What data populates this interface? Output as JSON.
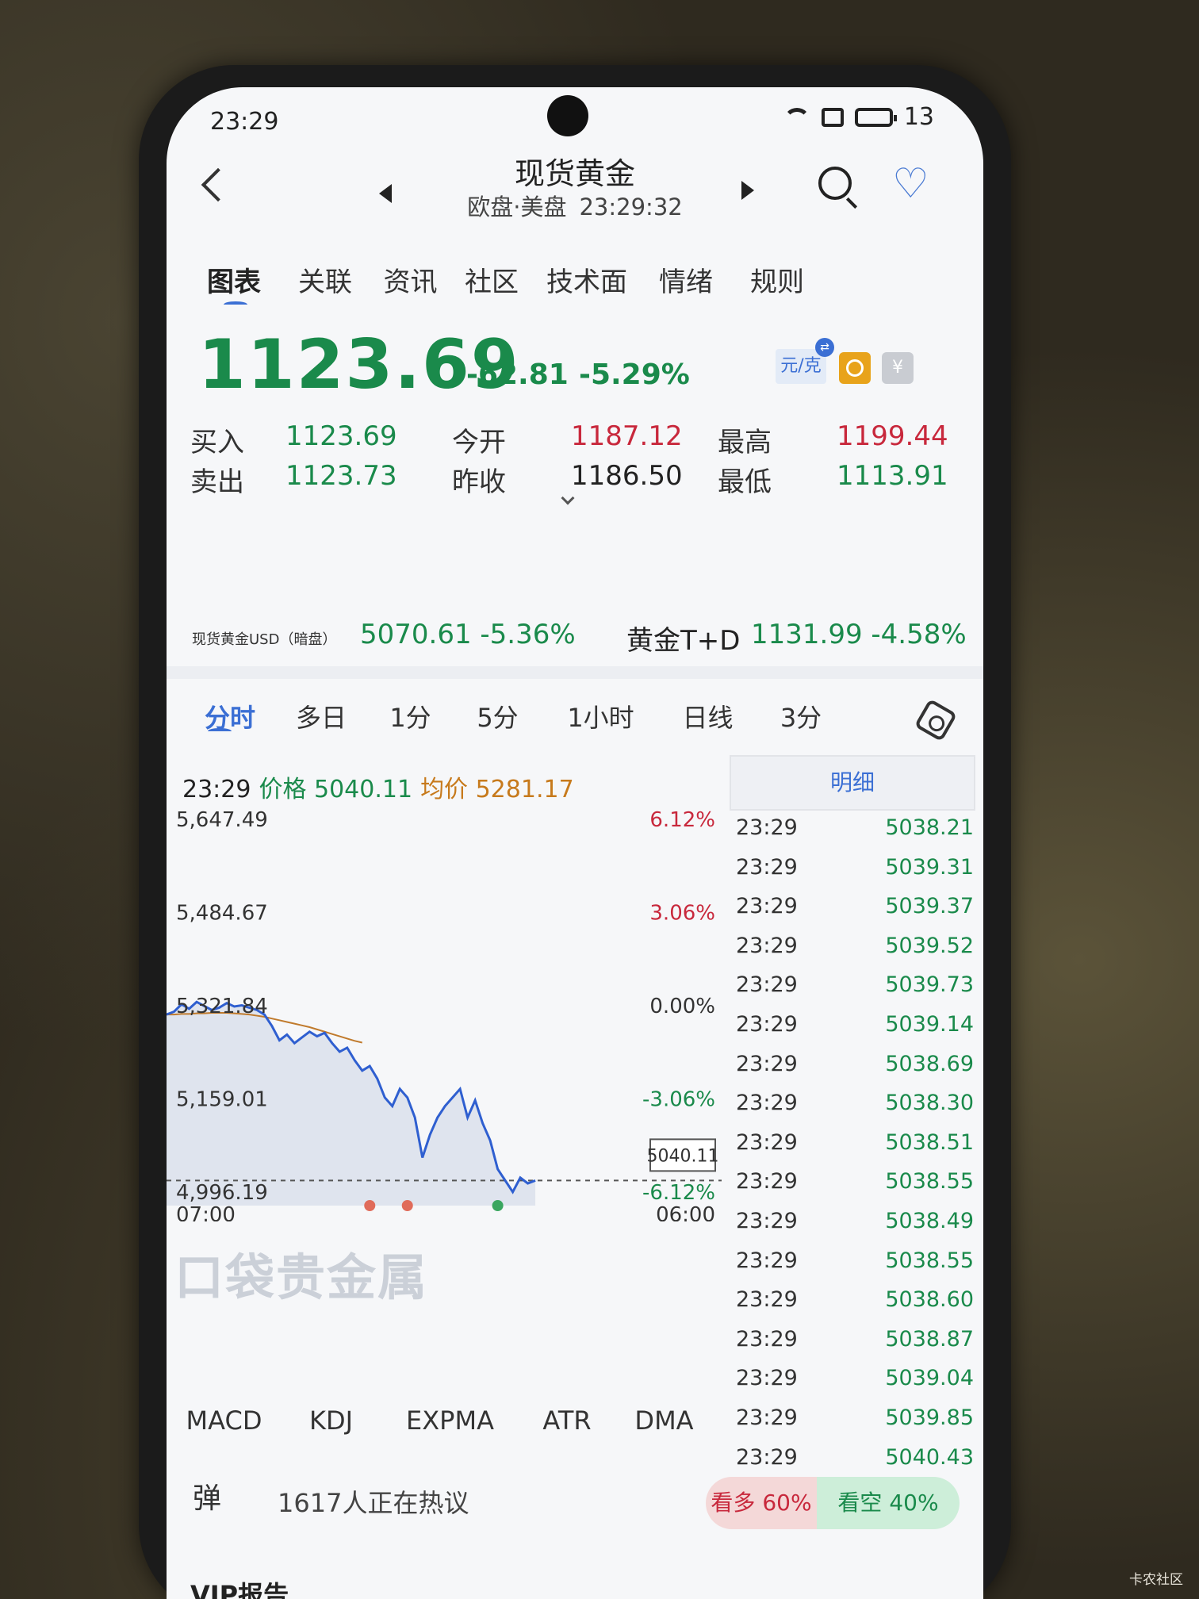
{
  "status": {
    "time": "23:29",
    "battery": "13"
  },
  "header": {
    "title": "现货黄金",
    "session": "欧盘·美盘",
    "clock": "23:29:32"
  },
  "tabs": [
    "图表",
    "关联",
    "资讯",
    "社区",
    "技术面",
    "情绪",
    "规则"
  ],
  "quote": {
    "price": "1123.69",
    "change": "-62.81",
    "change_pct": "-5.29%",
    "unit": "元/克",
    "rows": [
      {
        "l1": "买入",
        "v1": "1123.69",
        "l2": "今开",
        "v2": "1187.12",
        "l3": "最高",
        "v3": "1199.44"
      },
      {
        "l1": "卖出",
        "v1": "1123.73",
        "l2": "昨收",
        "v2": "1186.50",
        "l3": "最低",
        "v3": "1113.91"
      }
    ]
  },
  "related": {
    "name1": "现货黄金USD（暗盘）",
    "val1": "5070.61 -5.36%",
    "name2": "黄金T+D",
    "val2": "1131.99 -4.58%"
  },
  "chart_tabs": [
    "分时",
    "多日",
    "1分",
    "5分",
    "1小时",
    "日线",
    "3分"
  ],
  "chart_info": {
    "time": "23:29",
    "price_label": "价格 5040.11",
    "avg_label": "均价 5281.17"
  },
  "detail_tab": "明细",
  "detail_rows": [
    {
      "t": "23:29",
      "p": "5038.21"
    },
    {
      "t": "23:29",
      "p": "5039.31"
    },
    {
      "t": "23:29",
      "p": "5039.37"
    },
    {
      "t": "23:29",
      "p": "5039.52"
    },
    {
      "t": "23:29",
      "p": "5039.73"
    },
    {
      "t": "23:29",
      "p": "5039.14"
    },
    {
      "t": "23:29",
      "p": "5038.69"
    },
    {
      "t": "23:29",
      "p": "5038.30"
    },
    {
      "t": "23:29",
      "p": "5038.51"
    },
    {
      "t": "23:29",
      "p": "5038.55"
    },
    {
      "t": "23:29",
      "p": "5038.49"
    },
    {
      "t": "23:29",
      "p": "5038.55"
    },
    {
      "t": "23:29",
      "p": "5038.60"
    },
    {
      "t": "23:29",
      "p": "5038.87"
    },
    {
      "t": "23:29",
      "p": "5039.04"
    },
    {
      "t": "23:29",
      "p": "5039.85"
    },
    {
      "t": "23:29",
      "p": "5040.43"
    }
  ],
  "chart_data": {
    "type": "line",
    "y_labels_left": [
      "5,647.49",
      "5,484.67",
      "5,321.84",
      "5,159.01",
      "4,996.19"
    ],
    "y_labels_right": [
      "6.12%",
      "3.06%",
      "0.00%",
      "-3.06%",
      "-6.12%"
    ],
    "ylim": [
      4996.19,
      5647.49
    ],
    "x_labels": [
      "07:00",
      "06:00"
    ],
    "last_price_tag": "5040.11",
    "series": [
      {
        "values": [
          5330,
          5335,
          5348,
          5340,
          5352,
          5345,
          5338,
          5342,
          5350,
          5344,
          5346,
          5342,
          5338,
          5330,
          5310,
          5285,
          5295,
          5280,
          5290,
          5300,
          5292,
          5298,
          5280,
          5265,
          5272,
          5250,
          5232,
          5240,
          5218,
          5185,
          5170,
          5200,
          5185,
          5150,
          5080,
          5120,
          5150,
          5170,
          5185,
          5200,
          5150,
          5180,
          5140,
          5110,
          5060,
          5040,
          5020,
          5045,
          5035,
          5040
        ]
      },
      {
        "values": [
          5330,
          5330,
          5331,
          5331,
          5332,
          5332,
          5333,
          5333,
          5333,
          5332,
          5331,
          5330,
          5328,
          5326,
          5323,
          5320,
          5317,
          5314,
          5311,
          5308,
          5304,
          5300,
          5296,
          5292,
          5288,
          5284,
          5281
        ]
      }
    ],
    "markers": [
      {
        "x": 27,
        "color": "#e06b5a"
      },
      {
        "x": 32,
        "color": "#e06b5a"
      },
      {
        "x": 44,
        "color": "#3aa65f"
      }
    ],
    "colors": {
      "price": "#2f5fd0",
      "avg": "#c07a2c",
      "fill": "#dfe4ee"
    }
  },
  "indicators": [
    "MACD",
    "KDJ",
    "EXPMA",
    "ATR",
    "DMA"
  ],
  "bottom": {
    "bullet_glyph": "弹",
    "discuss": "1617人正在热议",
    "bull": "看多 60%",
    "bear": "看空 40%",
    "vip": "VIP报告"
  },
  "watermark": "口袋贵金属",
  "corner_watermark": "卡农社区"
}
